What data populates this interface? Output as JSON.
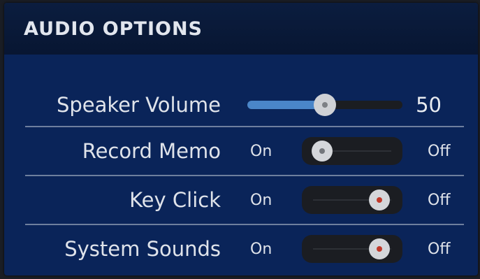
{
  "panel": {
    "title": "AUDIO OPTIONS"
  },
  "settings": {
    "speaker_volume": {
      "label": "Speaker Volume",
      "value": "50",
      "fraction": 0.5
    },
    "record_memo": {
      "label": "Record Memo",
      "on_label": "On",
      "off_label": "Off",
      "state": "on"
    },
    "key_click": {
      "label": "Key Click",
      "on_label": "On",
      "off_label": "Off",
      "state": "off"
    },
    "system_sounds": {
      "label": "System Sounds",
      "on_label": "On",
      "off_label": "Off",
      "state": "off"
    }
  },
  "colors": {
    "panel_bg": "#0a2459",
    "header_bg": "#081632",
    "slider_fill": "#4a86c9",
    "knob_dot_active": "#c0392b"
  }
}
